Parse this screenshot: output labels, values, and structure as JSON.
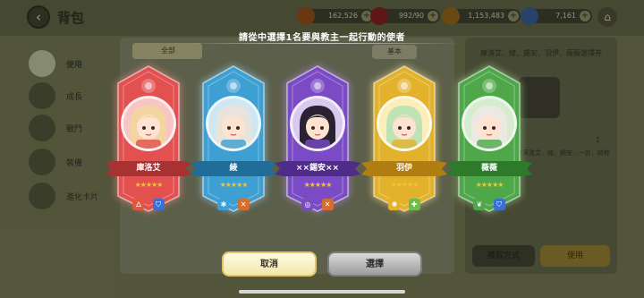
{
  "header": {
    "back_icon": "back-arrow-icon",
    "title": "背包",
    "resources": [
      {
        "icon": "bread-icon",
        "value": "162,526",
        "color": "#b45a1a"
      },
      {
        "icon": "red-gem-icon",
        "value": "992/90",
        "color": "#a82323"
      },
      {
        "icon": "gold-coin-icon",
        "value": "1,153,483",
        "color": "#b77f1b"
      },
      {
        "icon": "crystal-icon",
        "value": "7,161",
        "color": "#3f6fb6"
      }
    ],
    "home_icon": "home-icon"
  },
  "sidebar": {
    "items": [
      {
        "label": "使用",
        "active": true
      },
      {
        "label": "成長",
        "active": false
      },
      {
        "label": "戰鬥",
        "active": false
      },
      {
        "label": "裝備",
        "active": false
      },
      {
        "label": "進化卡片",
        "active": false
      }
    ]
  },
  "background": {
    "filter_label": "全部",
    "sort_label": "基本",
    "detail_title": "庫洛艾、綾、錫安、羽伊、薇薇選擇券",
    "detail_count": "1",
    "detail_desc": "選擇券，可以選擇庫洛艾、綾、錫安...一名，持有者可獲得20個",
    "obtain_label": "獲取方式",
    "use_label": "使用"
  },
  "modal": {
    "title": "請從中選擇1名要與教主一起行動的使者",
    "cancel_label": "取消",
    "select_label": "選擇",
    "cards": [
      {
        "name": "庫洛艾",
        "color": "#e2504f",
        "glow": "#ff8d8d",
        "band": "#a83232",
        "stars": "★★★★★",
        "tags": [
          "fire-icon",
          "shield-icon"
        ],
        "tag_colors": [
          "#e0573c",
          "#3c6fd6"
        ],
        "hair": "#f3d5a2",
        "bg": "#f7c6c4"
      },
      {
        "name": "綾",
        "color": "#3d9fd2",
        "glow": "#8fd4ff",
        "band": "#1f6d98",
        "stars": "★★★★★",
        "tags": [
          "snowflake-icon",
          "sword-icon"
        ],
        "tag_colors": [
          "#3ba1d6",
          "#d46d2d"
        ],
        "hair": "#e8e4dc",
        "bg": "#cfe6f3"
      },
      {
        "name": "××錫安××",
        "color": "#7a4bc4",
        "glow": "#b48cff",
        "band": "#4f2c8a",
        "stars": "★★★★★",
        "tags": [
          "spiral-icon",
          "sword-icon"
        ],
        "tag_colors": [
          "#7a4bc4",
          "#d46d2d"
        ],
        "hair": "#2a2233",
        "bg": "#d9c9ee"
      },
      {
        "name": "羽伊",
        "color": "#e3b22d",
        "glow": "#ffe08a",
        "band": "#b07d10",
        "stars": "★★★★★",
        "tags": [
          "sun-icon",
          "plus-icon"
        ],
        "tag_colors": [
          "#e3b22d",
          "#6cc04a"
        ],
        "hair": "#bfe3b5",
        "bg": "#fbeeb8"
      },
      {
        "name": "薇薇",
        "color": "#4ea84a",
        "glow": "#9be28f",
        "band": "#2d7a2a",
        "stars": "★★★★★",
        "tags": [
          "leaf-icon",
          "shield-icon"
        ],
        "tag_colors": [
          "#4ea84a",
          "#3c6fd6"
        ],
        "hair": "#ece8e2",
        "bg": "#d5eccf"
      }
    ]
  }
}
